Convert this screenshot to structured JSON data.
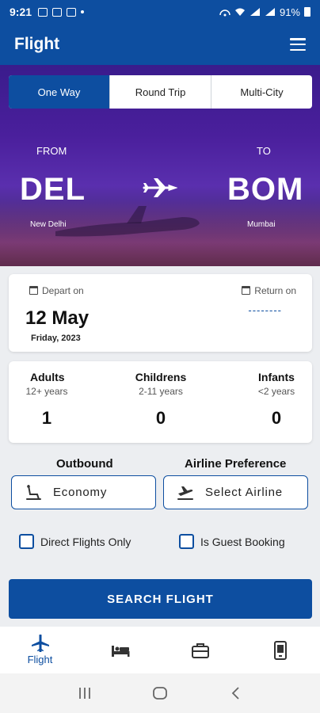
{
  "status_bar": {
    "time": "9:21",
    "battery": "91%"
  },
  "app_bar": {
    "title": "Flight"
  },
  "trip_tabs": [
    {
      "label": "One Way",
      "active": true
    },
    {
      "label": "Round Trip",
      "active": false
    },
    {
      "label": "Multi-City",
      "active": false
    }
  ],
  "route": {
    "from_label": "FROM",
    "from_code": "DEL",
    "from_city": "New Delhi",
    "to_label": "TO",
    "to_code": "BOM",
    "to_city": "Mumbai"
  },
  "dates": {
    "depart_label": "Depart on",
    "depart_date": "12 May",
    "depart_day": "Friday, 2023",
    "return_label": "Return on",
    "return_value": "--------"
  },
  "passengers": {
    "adults": {
      "label": "Adults",
      "age": "12+ years",
      "count": "1"
    },
    "children": {
      "label": "Childrens",
      "age": "2-11 years",
      "count": "0"
    },
    "infants": {
      "label": "Infants",
      "age": "<2 years",
      "count": "0"
    }
  },
  "preferences": {
    "outbound_label": "Outbound",
    "outbound_value": "Economy",
    "airline_label": "Airline Preference",
    "airline_value": "Select Airline"
  },
  "options": {
    "direct_flights": {
      "label": "Direct Flights Only",
      "checked": false
    },
    "guest_booking": {
      "label": "Is Guest Booking",
      "checked": false
    }
  },
  "search_button": "SEARCH FLIGHT",
  "bottom_nav": [
    {
      "icon": "flight-icon",
      "label": "Flight",
      "active": true
    },
    {
      "icon": "hotel-bed-icon",
      "label": "",
      "active": false
    },
    {
      "icon": "briefcase-icon",
      "label": "",
      "active": false
    },
    {
      "icon": "phone-icon",
      "label": "",
      "active": false
    }
  ],
  "colors": {
    "primary": "#0d4ea0",
    "background": "#eceef1"
  }
}
